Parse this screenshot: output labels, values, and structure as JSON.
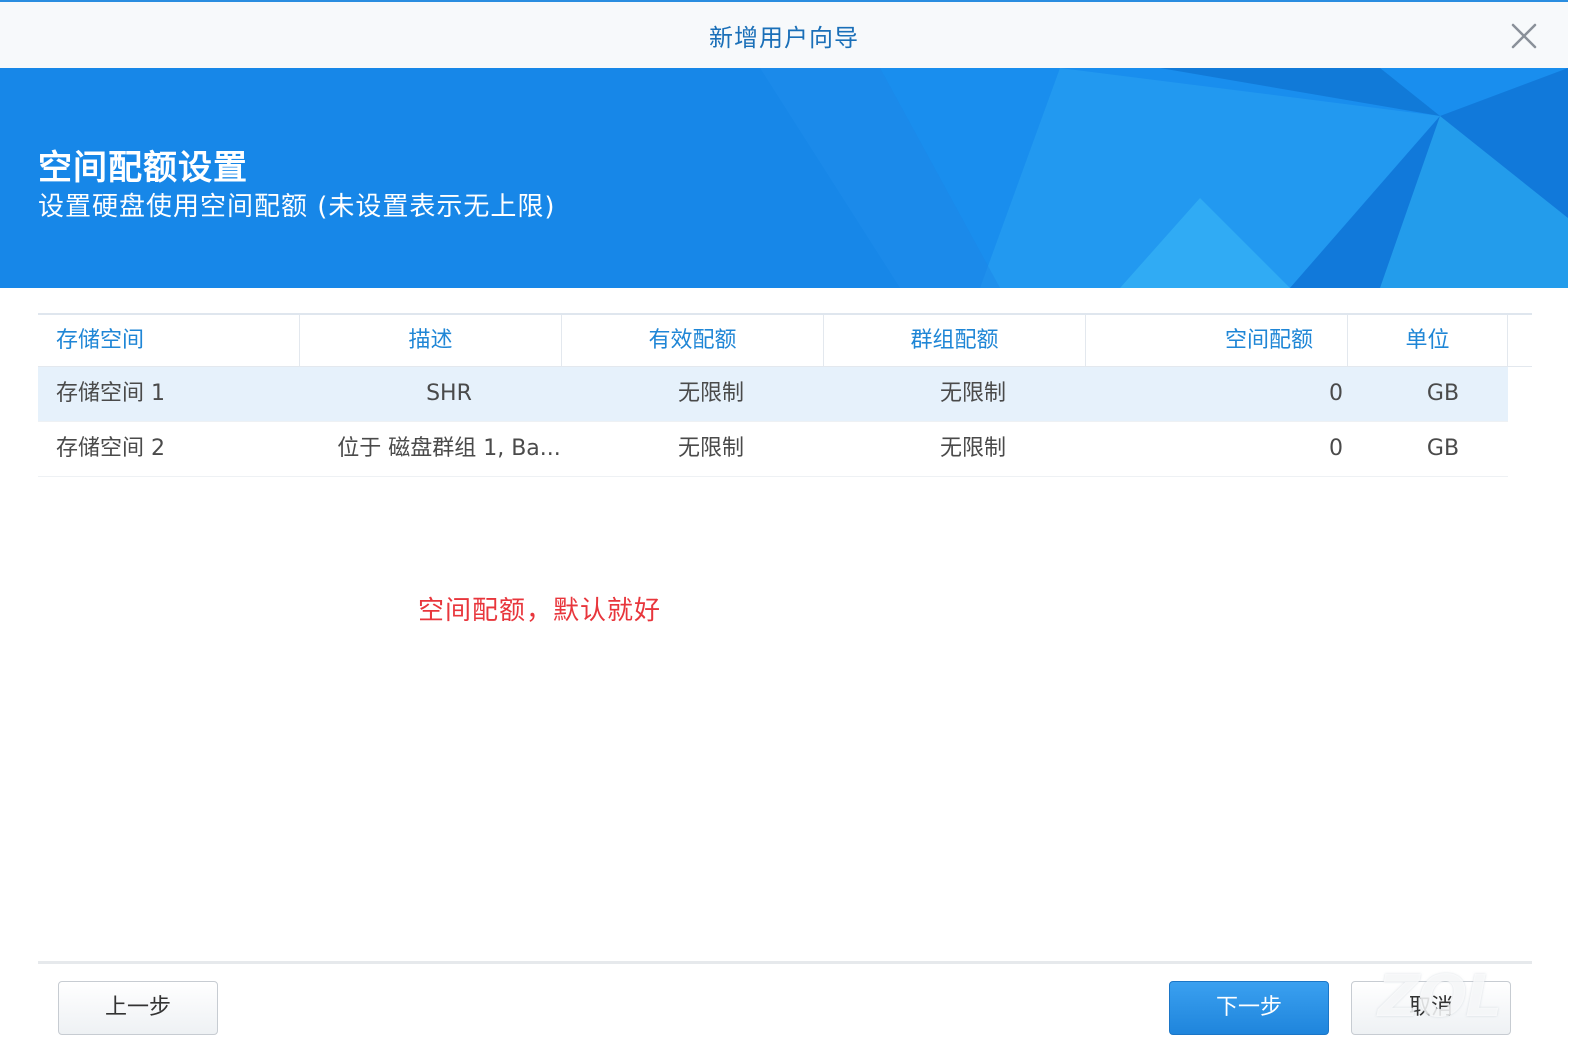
{
  "window": {
    "title": "新增用户向导"
  },
  "banner": {
    "heading": "空间配额设置",
    "subheading": "设置硬盘使用空间配额 (未设置表示无上限)",
    "background_color": "#1787e8"
  },
  "table": {
    "columns": [
      "存储空间",
      "描述",
      "有效配额",
      "群组配额",
      "空间配额",
      "单位"
    ],
    "rows": [
      {
        "volume": "存储空间 1",
        "description": "SHR",
        "effective_quota": "无限制",
        "group_quota": "无限制",
        "space_quota": "0",
        "unit": "GB",
        "selected": true
      },
      {
        "volume": "存储空间 2",
        "description": "位于 磁盘群组 1, Ba...",
        "effective_quota": "无限制",
        "group_quota": "无限制",
        "space_quota": "0",
        "unit": "GB",
        "selected": false
      }
    ]
  },
  "annotation": {
    "text": "空间配额，默认就好",
    "color": "#e8363c"
  },
  "footer": {
    "prev_label": "上一步",
    "next_label": "下一步",
    "cancel_label": "取消"
  },
  "watermark": {
    "text": "ZOL"
  },
  "colors": {
    "accent": "#1f86d6",
    "primary_button": "#2a8fe4",
    "selected_row": "#e6f1fb"
  }
}
